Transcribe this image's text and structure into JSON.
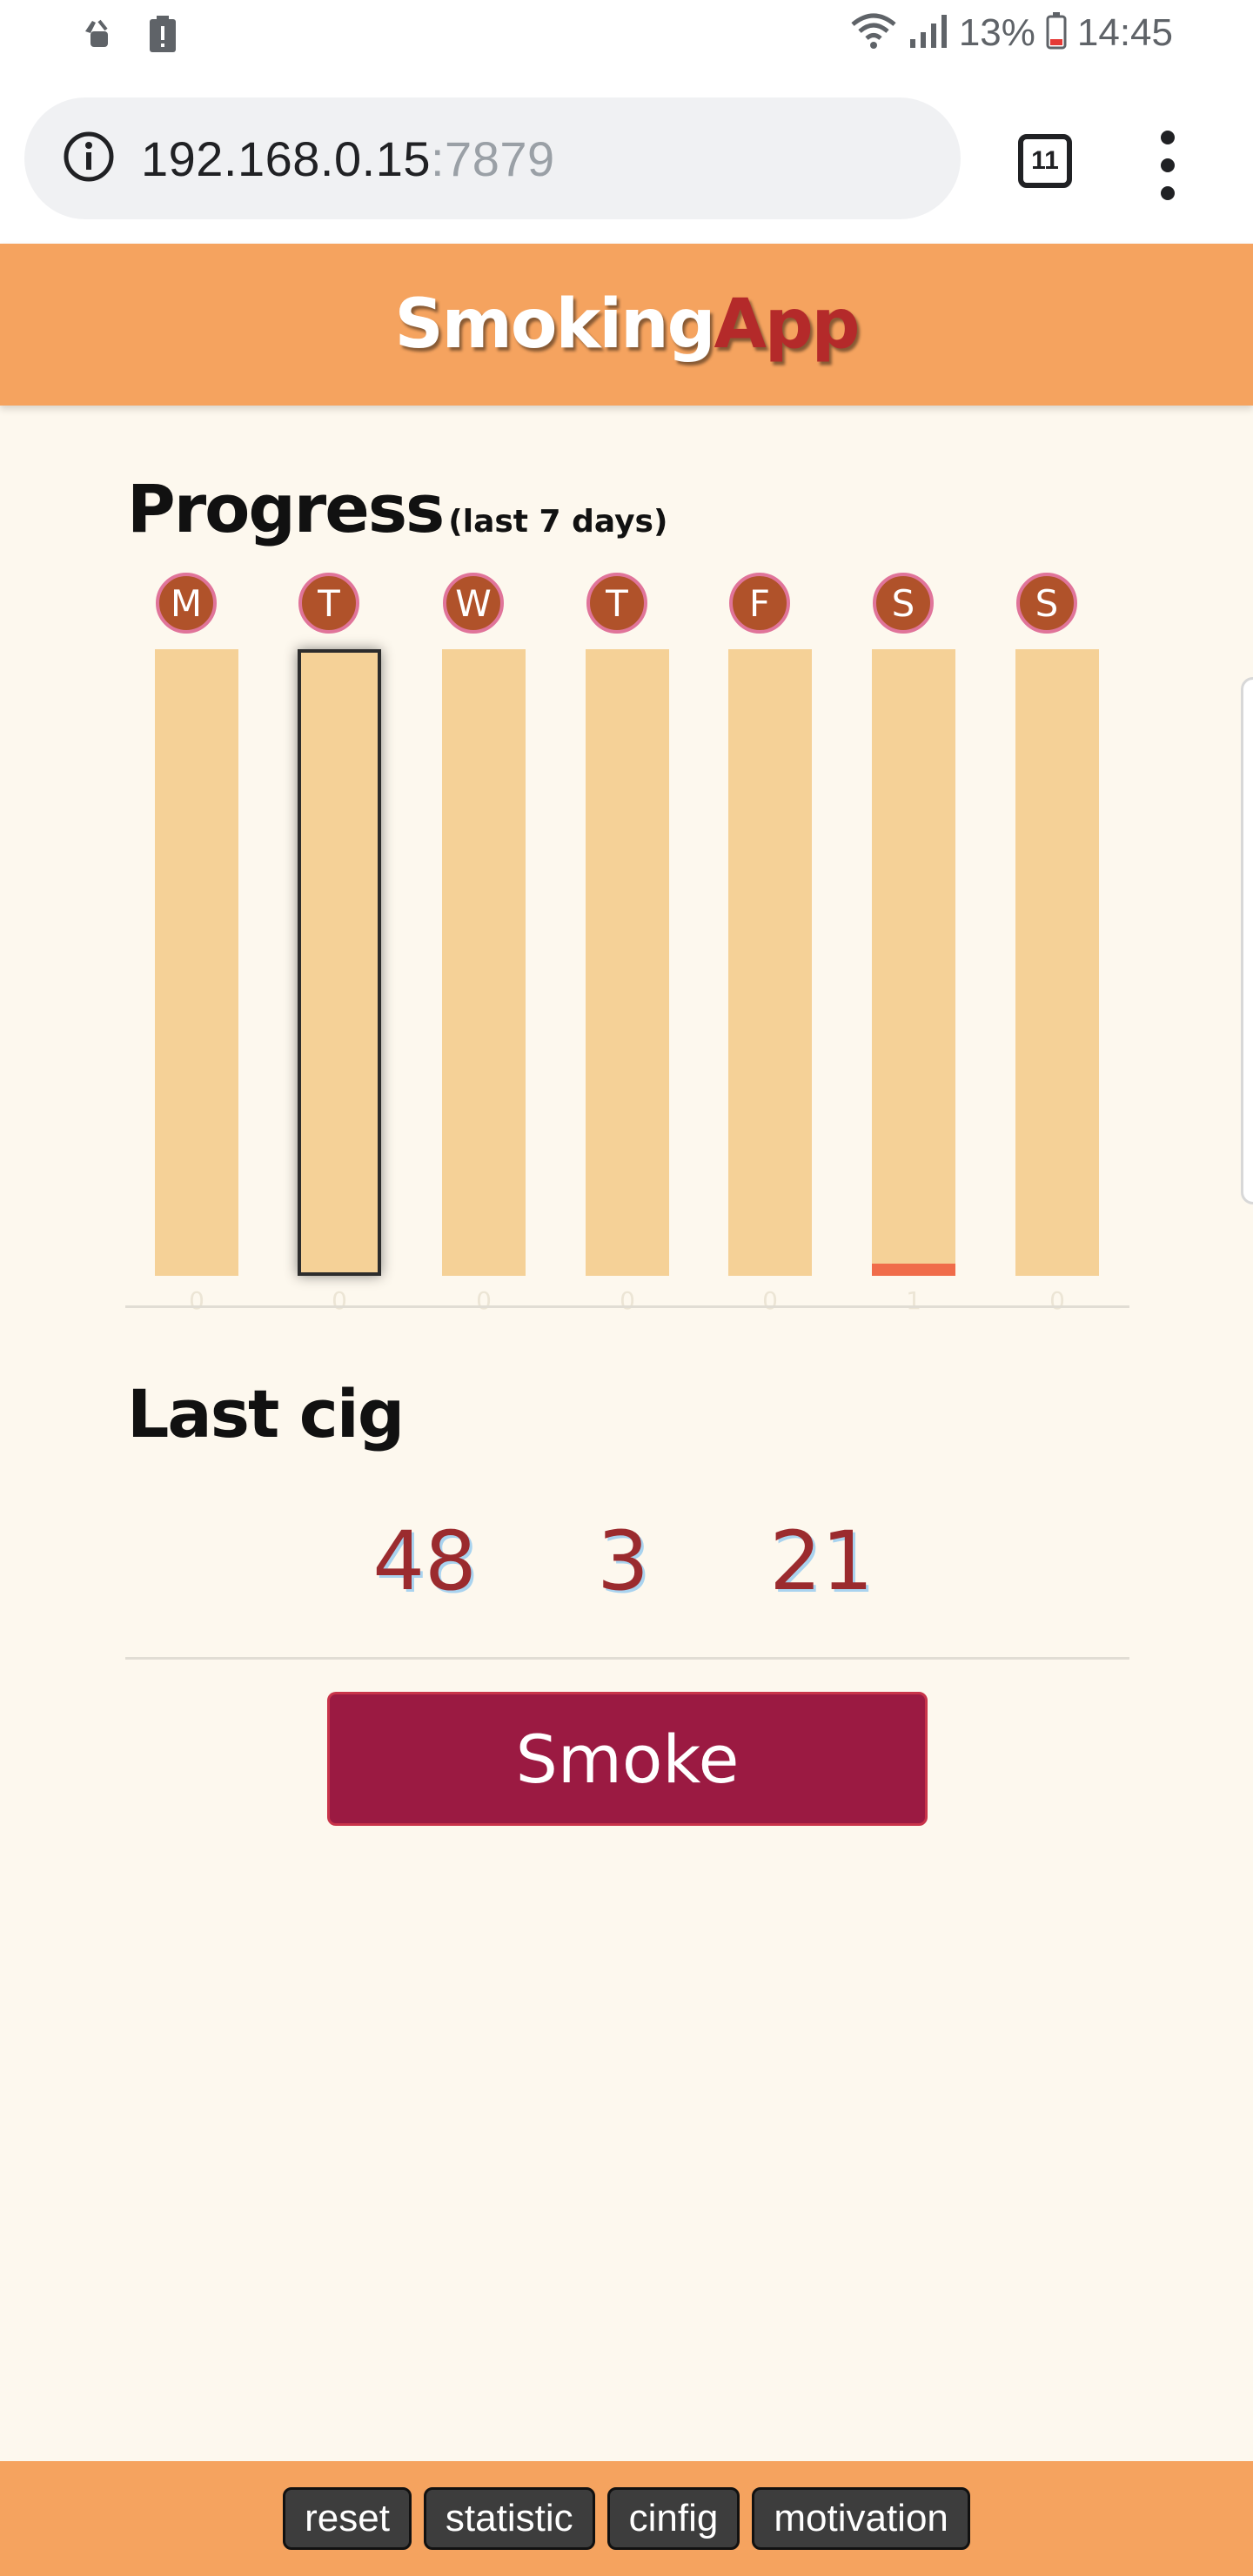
{
  "status_bar": {
    "battery_percent": "13%",
    "time": "14:45",
    "icons": [
      "android-robot-icon",
      "battery-alert-icon",
      "wifi-icon",
      "signal-icon",
      "battery-icon"
    ]
  },
  "browser": {
    "url_host": "192.168.0.15",
    "url_port": ":7879",
    "tab_count": "11"
  },
  "header": {
    "title_part1": "Smoking",
    "title_part2": "App"
  },
  "progress": {
    "title": "Progress",
    "subtitle": "(last 7 days)",
    "days": [
      "M",
      "T",
      "W",
      "T",
      "F",
      "S",
      "S"
    ],
    "counts": [
      "0",
      "0",
      "0",
      "0",
      "0",
      "1",
      "0"
    ],
    "selected_index": 1
  },
  "chart_data": {
    "type": "bar",
    "categories": [
      "M",
      "T",
      "W",
      "T",
      "F",
      "S",
      "S"
    ],
    "values": [
      0,
      0,
      0,
      0,
      0,
      1,
      0
    ],
    "title": "Progress",
    "subtitle": "(last 7 days)",
    "ylim": [
      0,
      50
    ],
    "colors": {
      "track": "#f5d197",
      "fill": "#f06c4a",
      "badge": "#b0522a"
    }
  },
  "last_cig": {
    "title": "Last cig",
    "values": [
      "48",
      "3",
      "21"
    ]
  },
  "actions": {
    "smoke_label": "Smoke"
  },
  "footer": {
    "buttons": [
      "reset",
      "statistic",
      "cinfig",
      "motivation"
    ]
  },
  "colors": {
    "header_bg": "#f5a35f",
    "page_bg": "#fdf8ee",
    "accent": "#9b1a42",
    "title_red": "#b42a2a"
  }
}
